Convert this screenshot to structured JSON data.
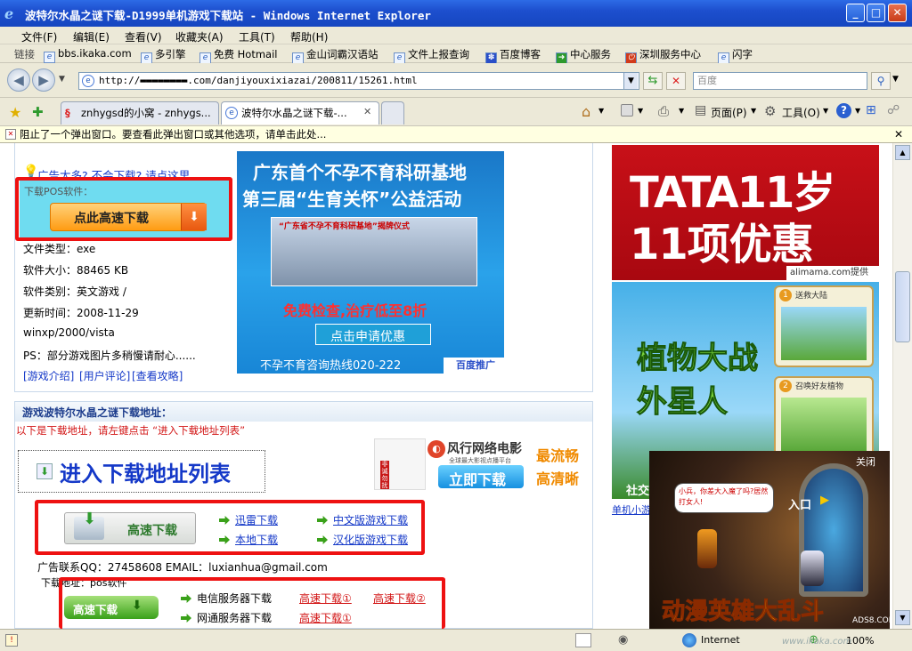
{
  "window": {
    "title": "波特尔水晶之谜下载-D1999单机游戏下载站 - Windows Internet Explorer",
    "minimize": "_",
    "maximize": "□",
    "close": "✕"
  },
  "menu": [
    "文件(F)",
    "编辑(E)",
    "查看(V)",
    "收藏夹(A)",
    "工具(T)",
    "帮助(H)"
  ],
  "links": {
    "label": "链接",
    "items": [
      "bbs.ikaka.com",
      "多引擎",
      "免费 Hotmail",
      "金山词霸汉语站",
      "文件上报查询",
      "百度博客",
      "中心服务",
      "深圳服务中心",
      "闪字"
    ]
  },
  "address": {
    "url": "http://▬▬▬▬▬▬▬▬.com/danjiyouxixiazai/200811/15261.html",
    "search_placeholder": "百度"
  },
  "tabs": [
    "znhygsd的小窝 - znhygs...",
    "波特尔水晶之谜下载-..."
  ],
  "toolbar": {
    "page": "页面(P)",
    "tools": "工具(O)"
  },
  "infobar": "阻止了一个弹出窗口。要查看此弹出窗口或其他选项，请单击此处...",
  "info": {
    "ad_hint": "广告太多? 不会下载? 请点这里",
    "pos_label": "下载POS软件：",
    "fast_download_btn": "点此高速下载",
    "file_type": "文件类型：exe",
    "file_size": "软件大小：88465 KB",
    "category": "软件类别：英文游戏 /",
    "updated": "更新时间：2008-11-29",
    "os": "winxp/2000/vista",
    "ps": "PS：部分游戏图片多稍慢请耐心......",
    "link1": "[游戏介绍]",
    "link2": "[用户评论]",
    "link3": "[查看攻略]"
  },
  "ad_banner": {
    "line1": "广东首个不孕不育科研基地",
    "line2": "第三届“生育关怀”公益活动",
    "sign": "“广东省不孕不育科研基地”揭牌仪式",
    "free": "免费检查,治疗低至8折",
    "apply": "点击申请优惠",
    "hotline": "不孕不育咨询热线020-222",
    "baidu": "百度推广"
  },
  "download": {
    "header": "游戏波特尔水晶之谜下载地址：",
    "notice": "以下是下载地址，请左键点击 “进入下载地址列表”",
    "enter_list": "进入下载地址列表",
    "fast": "高速下载",
    "thunder": "迅雷下载",
    "local": "本地下载",
    "chinese": "中文版游戏下载",
    "localized": "汉化版游戏下载",
    "contact": "广告联系QQ：27458608 EMAIL：luxianhua@gmail.com",
    "addr_label": "下载地址：pos软件",
    "fast2": "高速下载",
    "telecom": "电信服务器下载",
    "netcom": "网通服务器下载",
    "fast_dl_1": "高速下载①",
    "fast_dl_2": "高速下载②",
    "fast_dl_3": "高速下载①"
  },
  "fengxing": {
    "brand": "风行网络电影",
    "sub": "全球最大影视点播平台",
    "tag1": "最流畅",
    "tag2": "高清晰",
    "btn": "立即下载",
    "side": "非诚勿扰"
  },
  "right_ads": {
    "tata1": "TATA11岁",
    "tata2": "11项优惠",
    "alimama": "alimama.com提供",
    "pvz_title": "植物大战外星人",
    "step1": "送救大陆",
    "step2": "召唤好友植物",
    "social": "社交",
    "caption": "单机小游"
  },
  "popup_ad": {
    "close": "关闭",
    "bubble": "小兵，你差大入魔了吗?居然打女人!",
    "enter": "入口",
    "title": "动漫英雄大乱斗",
    "watermark1": "ADS8.COM",
    "watermark2": "www.ikaka.com"
  },
  "status": {
    "zone": "Internet",
    "zoom": "100%"
  },
  "colors": {
    "titlebar": "#1d4fce",
    "highlight_red": "#ee1111",
    "link_blue": "#1438c8",
    "chrome": "#ece9d8"
  }
}
